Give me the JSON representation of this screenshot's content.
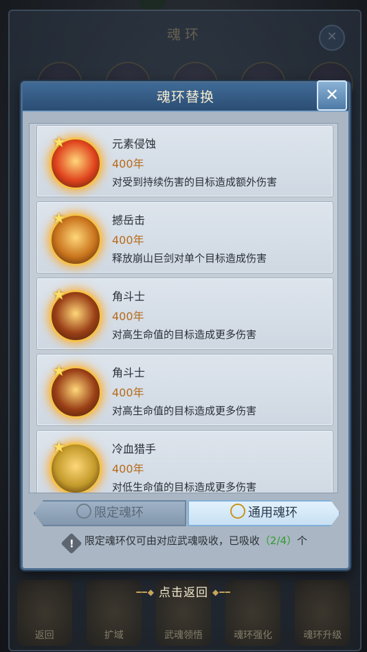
{
  "background": {
    "title": "魂环",
    "tabs": [
      "返回",
      "扩域",
      "武魂领悟",
      "魂环强化",
      "魂环升级"
    ]
  },
  "dialog": {
    "title": "魂环替换",
    "close_label": "✕"
  },
  "rings": [
    {
      "name": "元素侵蚀",
      "year": "400年",
      "desc": "对受到持续伤害的目标造成额外伤害",
      "icon": "flame-spirit-icon",
      "color": "#e0431d"
    },
    {
      "name": "撼岳击",
      "year": "400年",
      "desc": "释放崩山巨剑对单个目标造成伤害",
      "icon": "sword-icon",
      "color": "#c9741d"
    },
    {
      "name": "角斗士",
      "year": "400年",
      "desc": "对高生命值的目标造成更多伤害",
      "icon": "horned-warrior-icon",
      "color": "#9a3f16"
    },
    {
      "name": "角斗士",
      "year": "400年",
      "desc": "对高生命值的目标造成更多伤害",
      "icon": "horned-warrior-icon",
      "color": "#9a3f16"
    },
    {
      "name": "冷血猎手",
      "year": "400年",
      "desc": "对低生命值的目标造成更多伤害",
      "icon": "blood-blade-icon",
      "color": "#c29a2a"
    }
  ],
  "tabs": {
    "limited": "限定魂环",
    "general": "通用魂环"
  },
  "notice": {
    "text": "限定魂环仅可由对应武魂吸收，已吸收",
    "count": "（2/4）",
    "suffix": "个"
  },
  "back_hint": "点击返回"
}
